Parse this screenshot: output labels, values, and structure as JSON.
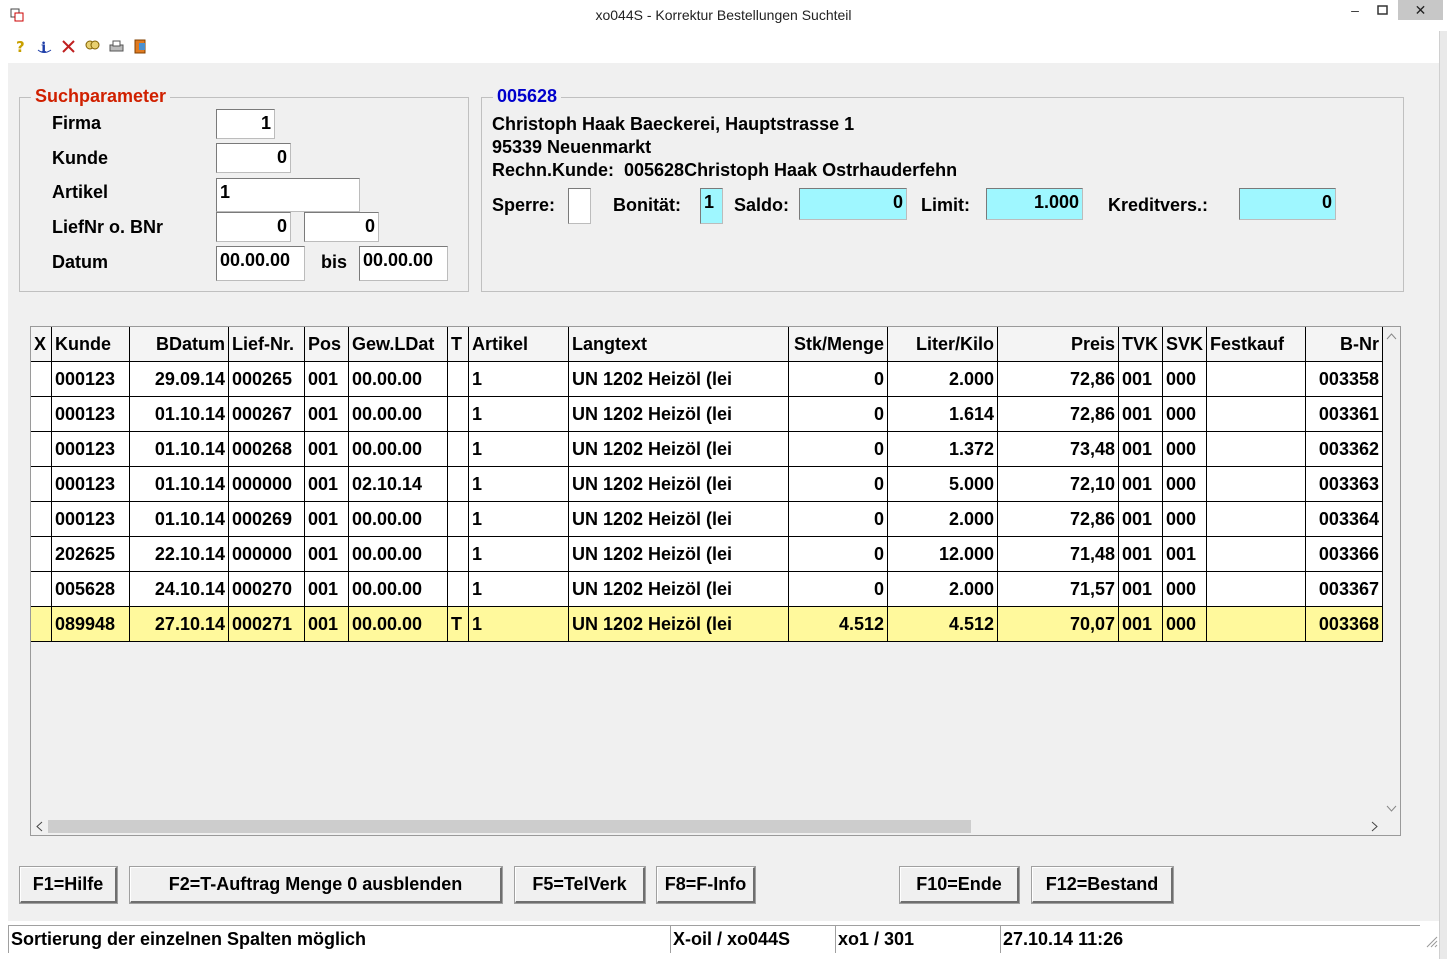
{
  "window": {
    "title": "xo044S - Korrektur Bestellungen Suchteil",
    "min_symbol": "–",
    "close_symbol": "✕"
  },
  "toolbar": {
    "icons": [
      "help-icon",
      "info-icon",
      "delete-icon",
      "search-icon",
      "print-icon",
      "exit-icon"
    ]
  },
  "search": {
    "legend": "Suchparameter",
    "firma_label": "Firma",
    "firma_value": "1",
    "kunde_label": "Kunde",
    "kunde_value": "0",
    "artikel_label": "Artikel",
    "artikel_value": "1",
    "liefnr_label": "LiefNr o. BNr",
    "liefnr_value": "0",
    "bnr_value": "0",
    "datum_label": "Datum",
    "datum_from": "00.00.00",
    "bis_label": "bis",
    "datum_to": "00.00.00"
  },
  "customer": {
    "legend": "005628",
    "name_line": "Christoph Haak Baeckerei, Hauptstrasse 1",
    "city_line": "95339 Neuenmarkt",
    "rechn_line": "Rechn.Kunde:  005628Christoph Haak Ostrhauderfehn",
    "sperre_label": "Sperre:",
    "sperre_value": "",
    "bonitaet_label": "Bonität:",
    "bonitaet_value": "1",
    "saldo_label": "Saldo:",
    "saldo_value": "0",
    "limit_label": "Limit:",
    "limit_value": "1.000",
    "kreditvers_label": "Kreditvers.:",
    "kreditvers_value": "0"
  },
  "table": {
    "columns": [
      "X",
      "Kunde",
      "BDatum",
      "Lief-Nr.",
      "Pos",
      "Gew.LDat",
      "T",
      "Artikel",
      "Langtext",
      "Stk/Menge",
      "Liter/Kilo",
      "Preis",
      "TVK",
      "SVK",
      "Festkauf",
      "B-Nr"
    ],
    "rows": [
      [
        "",
        "000123",
        "29.09.14",
        "000265",
        "001",
        "00.00.00",
        "",
        "1",
        "UN 1202 Heizöl (lei",
        "0",
        "2.000",
        "72,86",
        "001",
        "000",
        "",
        "003358"
      ],
      [
        "",
        "000123",
        "01.10.14",
        "000267",
        "001",
        "00.00.00",
        "",
        "1",
        "UN 1202 Heizöl (lei",
        "0",
        "1.614",
        "72,86",
        "001",
        "000",
        "",
        "003361"
      ],
      [
        "",
        "000123",
        "01.10.14",
        "000268",
        "001",
        "00.00.00",
        "",
        "1",
        "UN 1202 Heizöl (lei",
        "0",
        "1.372",
        "73,48",
        "001",
        "000",
        "",
        "003362"
      ],
      [
        "",
        "000123",
        "01.10.14",
        "000000",
        "001",
        "02.10.14",
        "",
        "1",
        "UN 1202 Heizöl (lei",
        "0",
        "5.000",
        "72,10",
        "001",
        "000",
        "",
        "003363"
      ],
      [
        "",
        "000123",
        "01.10.14",
        "000269",
        "001",
        "00.00.00",
        "",
        "1",
        "UN 1202 Heizöl (lei",
        "0",
        "2.000",
        "72,86",
        "001",
        "000",
        "",
        "003364"
      ],
      [
        "",
        "202625",
        "22.10.14",
        "000000",
        "001",
        "00.00.00",
        "",
        "1",
        "UN 1202 Heizöl (lei",
        "0",
        "12.000",
        "71,48",
        "001",
        "001",
        "",
        "003366"
      ],
      [
        "",
        "005628",
        "24.10.14",
        "000270",
        "001",
        "00.00.00",
        "",
        "1",
        "UN 1202 Heizöl (lei",
        "0",
        "2.000",
        "71,57",
        "001",
        "000",
        "",
        "003367"
      ],
      [
        "",
        "089948",
        "27.10.14",
        "000271",
        "001",
        "00.00.00",
        "T",
        "1",
        "UN 1202 Heizöl (lei",
        "4.512",
        "4.512",
        "70,07",
        "001",
        "000",
        "",
        "003368"
      ]
    ],
    "selected_row": 7,
    "selected_color": "#fff99c"
  },
  "buttons": {
    "f1": "F1=Hilfe",
    "f2": "F2=T-Auftrag Menge 0 ausblenden",
    "f5": "F5=TelVerk",
    "f8": "F8=F-Info",
    "f10": "F10=Ende",
    "f12": "F12=Bestand"
  },
  "status": {
    "message": "Sortierung der einzelnen Spalten möglich",
    "program": "X-oil / xo044S",
    "user": "xo1 / 301",
    "datetime": "27.10.14 11:26"
  },
  "colors": {
    "legend_red": "#d02000",
    "legend_blue": "#0000cc",
    "cyan_field": "#9ff7ff"
  }
}
